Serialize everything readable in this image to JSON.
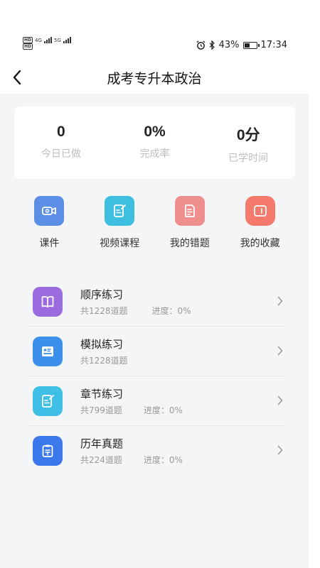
{
  "status_bar": {
    "sim1": "HD",
    "sim2": "HD",
    "net1": "4G",
    "net2": "5G",
    "battery_text": "43%",
    "battery_level": 0.43,
    "time": "17:34"
  },
  "header": {
    "title": "成考专升本政治"
  },
  "stats": [
    {
      "value": "0",
      "label": "今日已做"
    },
    {
      "value": "0%",
      "label": "完成率"
    },
    {
      "value": "0分",
      "label": "已学时间"
    }
  ],
  "shortcuts": [
    {
      "label": "课件",
      "icon": "video-camera-icon",
      "color": "#5b8fe6"
    },
    {
      "label": "视频课程",
      "icon": "edit-document-icon",
      "color": "#3fbfe0"
    },
    {
      "label": "我的错题",
      "icon": "document-icon",
      "color": "#ee8f8d"
    },
    {
      "label": "我的收藏",
      "icon": "wallet-icon",
      "color": "#f47a6c"
    }
  ],
  "practice": [
    {
      "title": "顺序练习",
      "count": "共1228道题",
      "progress": "进度：0%",
      "icon": "book-icon",
      "color": "#9a6ce0"
    },
    {
      "title": "模拟练习",
      "count": "共1228道题",
      "progress": "",
      "icon": "id-card-icon",
      "color": "#3d8fec"
    },
    {
      "title": "章节练习",
      "count": "共799道题",
      "progress": "进度：0%",
      "icon": "edit-document-icon",
      "color": "#3ec0e6"
    },
    {
      "title": "历年真题",
      "count": "共224道题",
      "progress": "进度：0%",
      "icon": "clipboard-icon",
      "color": "#3b78ec"
    }
  ]
}
